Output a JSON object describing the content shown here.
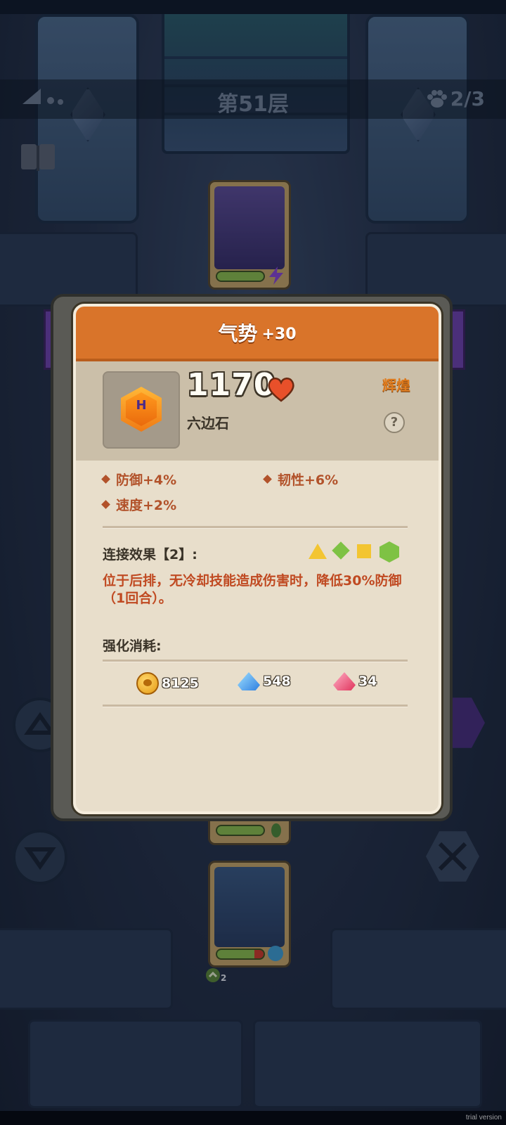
{
  "hud": {
    "floor_title": "第51层",
    "pet_count": "2/3",
    "icons": [
      "signal-icon",
      "book-icon",
      "paw-icon"
    ]
  },
  "modal": {
    "title": "气势",
    "title_bonus": "+30",
    "item": {
      "icon": "hexagon-gem-icon",
      "icon_letter": "H",
      "power": "1170",
      "rarity": "辉煌",
      "name": "六边石"
    },
    "stats": [
      {
        "label": "防御+4%"
      },
      {
        "label": "韧性+6%"
      },
      {
        "label": "速度+2%"
      }
    ],
    "link_effect": {
      "label": "连接效果【2】:",
      "shapes": [
        "triangle-yellow",
        "diamond-green",
        "square-yellow",
        "hexagon-green"
      ],
      "description": "位于后排，无冷却技能造成伤害时，降低30%防御（1回合）。"
    },
    "upgrade": {
      "label": "强化消耗:",
      "costs": [
        {
          "icon": "paw-coin-icon",
          "amount": "8125"
        },
        {
          "icon": "blue-crystal-icon",
          "amount": "548"
        },
        {
          "icon": "red-crystal-icon",
          "amount": "34"
        }
      ]
    }
  },
  "footer": {
    "watermark": "trial version",
    "unit_level": "2"
  },
  "colors": {
    "header_orange": "#d9742a",
    "panel_cream": "#e8decb",
    "stat_red": "#b2522a",
    "rarity_orange": "#e07c1e"
  }
}
